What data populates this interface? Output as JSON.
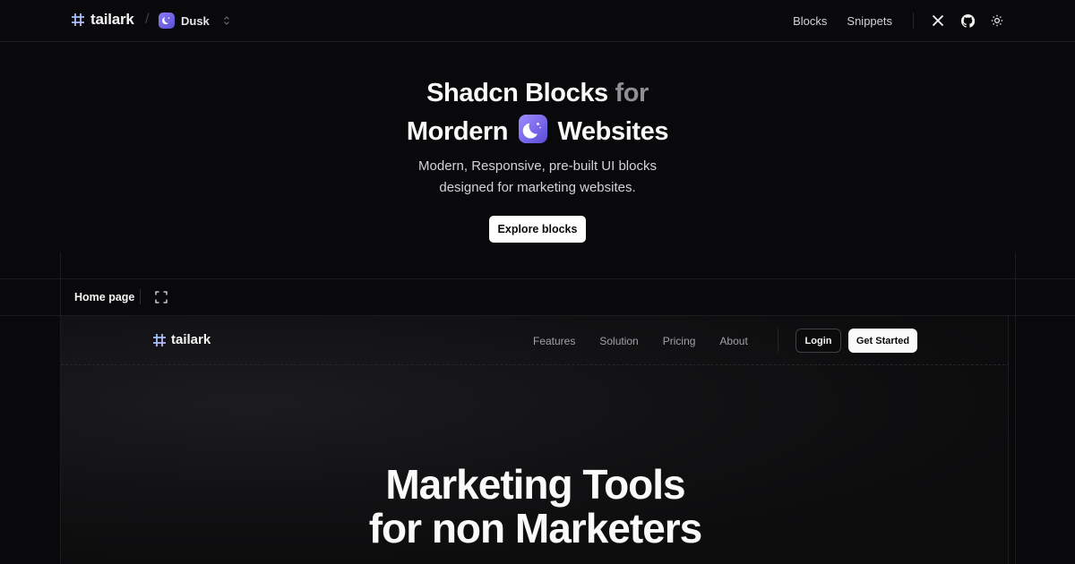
{
  "header": {
    "brand": "tailark",
    "separator": "/",
    "theme_name": "Dusk",
    "links": [
      "Blocks",
      "Snippets"
    ],
    "icons": [
      "x-logo-icon",
      "github-icon",
      "sun-icon"
    ]
  },
  "hero": {
    "title_line1_main": "Shadcn Blocks",
    "title_line1_muted": "for",
    "title_line2_a": "Mordern",
    "title_line2_b": "Websites",
    "subtitle_line1": "Modern, Responsive, pre-built UI blocks",
    "subtitle_line2": "designed for marketing websites.",
    "cta_label": "Explore blocks"
  },
  "preview_toolbar": {
    "tab_label": "Home page",
    "expand_icon": "fullscreen-icon"
  },
  "preview": {
    "brand": "tailark",
    "nav_links": [
      "Features",
      "Solution",
      "Pricing",
      "About"
    ],
    "login_label": "Login",
    "get_started_label": "Get Started",
    "hero_line1": "Marketing Tools",
    "hero_line2": "for non Marketers"
  },
  "colors": {
    "background": "#09090b",
    "accent_gradient_start": "#9d8cff",
    "accent_gradient_end": "#5a4ad8",
    "brand_icon": "#7dd3fc"
  }
}
